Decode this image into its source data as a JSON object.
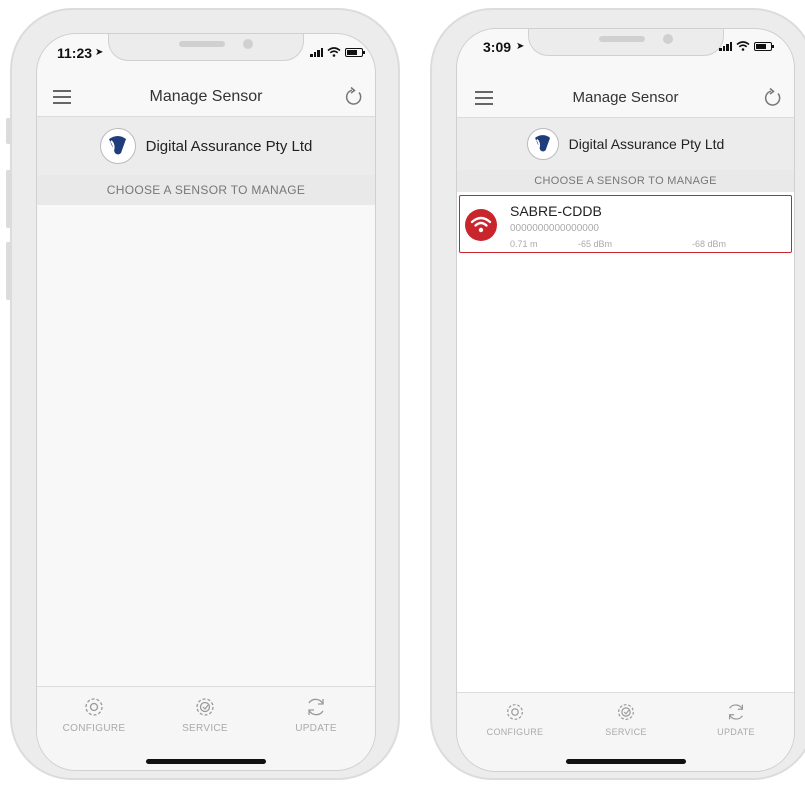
{
  "phones": [
    {
      "status_time": "11:23",
      "nav_title": "Manage Sensor",
      "company_name": "Digital Assurance Pty Ltd",
      "section_label": "CHOOSE A SENSOR TO MANAGE",
      "sensors": [],
      "tabs": [
        {
          "label": "CONFIGURE",
          "icon": "gear-icon"
        },
        {
          "label": "SERVICE",
          "icon": "service-gear-icon"
        },
        {
          "label": "UPDATE",
          "icon": "sync-icon"
        }
      ]
    },
    {
      "status_time": "3:09",
      "nav_title": "Manage Sensor",
      "company_name": "Digital Assurance Pty Ltd",
      "section_label": "CHOOSE A SENSOR TO MANAGE",
      "sensors": [
        {
          "name": "SABRE-CDDB",
          "id": "0000000000000000",
          "distance": "0.71 m",
          "rssi_1": "-65 dBm",
          "rssi_2": "-68 dBm",
          "icon": "wifi-icon"
        }
      ],
      "tabs": [
        {
          "label": "CONFIGURE",
          "icon": "gear-icon"
        },
        {
          "label": "SERVICE",
          "icon": "service-gear-icon"
        },
        {
          "label": "UPDATE",
          "icon": "sync-icon"
        }
      ]
    }
  ],
  "colors": {
    "accent": "#c9252c",
    "frame": "#ececec",
    "screen": "#f8f8f8"
  }
}
